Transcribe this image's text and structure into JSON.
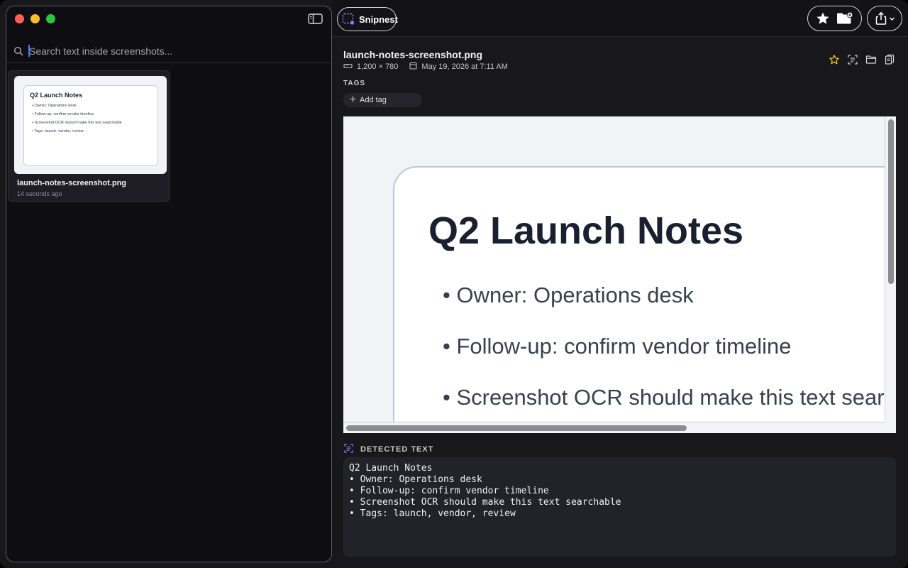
{
  "sidebar": {
    "search": {
      "placeholder": "Search text inside screenshots...",
      "value": ""
    },
    "items": [
      {
        "name": "launch-notes-screenshot.png",
        "time": "14 seconds ago",
        "thumbnail": {
          "title": "Q2 Launch Notes",
          "lines": [
            "• Owner: Operations desk",
            "• Follow-up: confirm vendor timeline",
            "• Screenshot OCR should make this text searchable",
            "• Tags: launch, vendor, review"
          ]
        }
      }
    ]
  },
  "toolbar": {
    "app_name": "Snipnest"
  },
  "detail": {
    "filename": "launch-notes-screenshot.png",
    "dimensions": "1,200 × 780",
    "date": "May 19, 2026 at 7:11 AM",
    "tags_label": "TAGS",
    "add_tag_label": "Add tag",
    "preview": {
      "title": "Q2 Launch Notes",
      "lines": [
        "• Owner: Operations desk",
        "• Follow-up: confirm vendor timeline",
        "• Screenshot OCR should make this text searchable"
      ]
    },
    "detected_text_label": "DETECTED TEXT",
    "detected_text": "Q2 Launch Notes\n• Owner: Operations desk\n• Follow-up: confirm vendor timeline\n• Screenshot OCR should make this text searchable\n• Tags: launch, vendor, review"
  },
  "colors": {
    "accent": "#4a7dff",
    "favorite_star": "#f5c518",
    "background": "#18181c",
    "sidebar_bg": "#0e0e12"
  },
  "icons": [
    "sidebar-toggle-icon",
    "search-icon",
    "app-logo-icon",
    "star-icon",
    "folder-add-icon",
    "share-icon",
    "chevron-down-icon",
    "ruler-icon",
    "calendar-icon",
    "favorite-star-icon",
    "text-scan-icon",
    "folder-icon",
    "copy-icon",
    "plus-icon"
  ]
}
